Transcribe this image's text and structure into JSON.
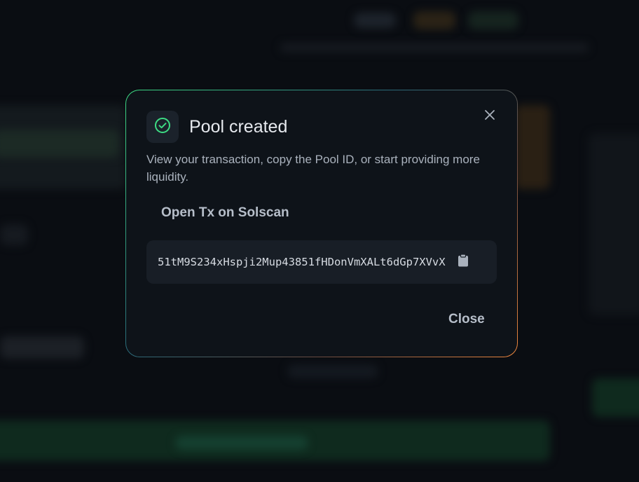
{
  "modal": {
    "title": "Pool created",
    "description": "View your transaction, copy the Pool ID, or start providing more liquidity.",
    "solscan_link": "Open Tx on Solscan",
    "pool_id": "51tM9S234xHspji2Mup43851fHDonVmXALt6dGp7XVvX",
    "close_label": "Close",
    "icons": {
      "status": "check-circle-icon",
      "dismiss": "close-icon",
      "copy": "clipboard-icon"
    },
    "colors": {
      "success": "#3ddc84",
      "accent_orange": "#f0883e",
      "panel": "#0e1319"
    }
  }
}
